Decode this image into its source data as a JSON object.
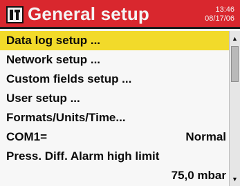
{
  "header": {
    "title": "General setup",
    "time": "13:46",
    "date": "08/17/06",
    "icon": "setup-wrench-icon"
  },
  "menu": {
    "items": [
      {
        "label": "Data log setup ...",
        "selected": true
      },
      {
        "label": "Network setup ..."
      },
      {
        "label": "Custom fields setup ..."
      },
      {
        "label": "User setup ..."
      },
      {
        "label": "Formats/Units/Time..."
      },
      {
        "label": "COM1=",
        "value": "Normal"
      },
      {
        "label": "Press. Diff. Alarm high limit",
        "value": "75,0 mbar"
      }
    ]
  },
  "scrollbar": {
    "up_icon": "▲",
    "down_icon": "▼"
  },
  "colors": {
    "header_bg": "#d9272e",
    "selection_bg": "#f2da2a",
    "text": "#0a0a0a"
  }
}
